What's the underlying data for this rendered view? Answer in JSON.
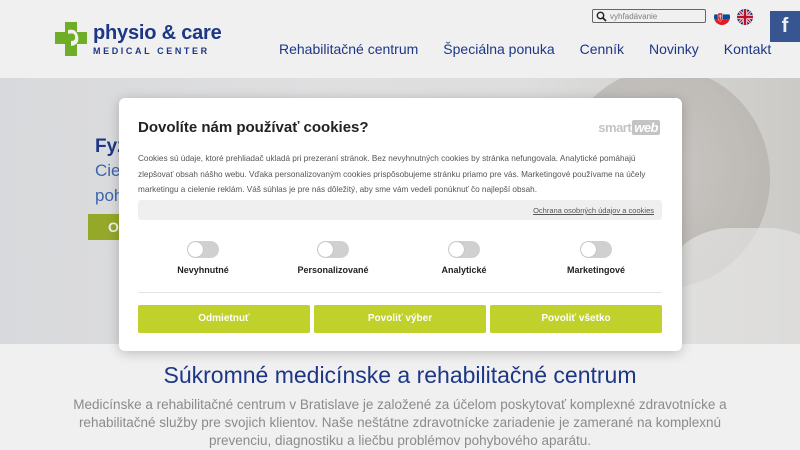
{
  "brand": {
    "name": "physio & care",
    "subtitle": "MEDICAL CENTER"
  },
  "nav": [
    "Rehabilitačné centrum",
    "Špeciálna ponuka",
    "Cenník",
    "Novinky",
    "Kontakt"
  ],
  "search": {
    "placeholder": "vyhľadávanie"
  },
  "social": {
    "facebook": "f"
  },
  "hero": {
    "title": "Fyz",
    "line1": "Cie",
    "line2": "poh",
    "button": "O"
  },
  "cookie": {
    "title": "Dovolíte nám používať cookies?",
    "brand_part1": "smart",
    "brand_part2": "web",
    "body": "Cookies sú údaje, ktoré prehliadač ukladá pri prezeraní stránok. Bez nevyhnutných cookies by stránka nefungovala. Analytické pomáhajú zlepšovať obsah nášho webu. Vďaka personalizovaným cookies prispôsobujeme stránku priamo pre vás. Marketingové používame na účely marketingu a cielenie reklám. Váš súhlas je pre nás dôležitý, aby sme vám vedeli ponúknuť čo najlepší obsah.",
    "policy_link": "Ochrana osobných údajov a cookies",
    "toggles": [
      "Nevyhnutné",
      "Personalizované",
      "Analytické",
      "Marketingové"
    ],
    "buttons": {
      "reject": "Odmietnuť",
      "select": "Povoliť výber",
      "all": "Povoliť všetko"
    }
  },
  "intro": {
    "title": "Súkromné medicínske a rehabilitačné centrum",
    "body": "Medicínske a rehabilitačné centrum v Bratislave je založené za účelom poskytovať komplexné zdravotnícke a rehabilitačné služby pre svojich klientov. Naše neštátne zdravotnícke zariadenie je zamerané na komplexnú prevenciu, diagnostiku a liečbu problémov pohybového aparátu."
  },
  "colors": {
    "primary": "#1f3b8f",
    "accent": "#bfd12a",
    "logo_green": "#76b82a",
    "facebook": "#3b5b99"
  }
}
